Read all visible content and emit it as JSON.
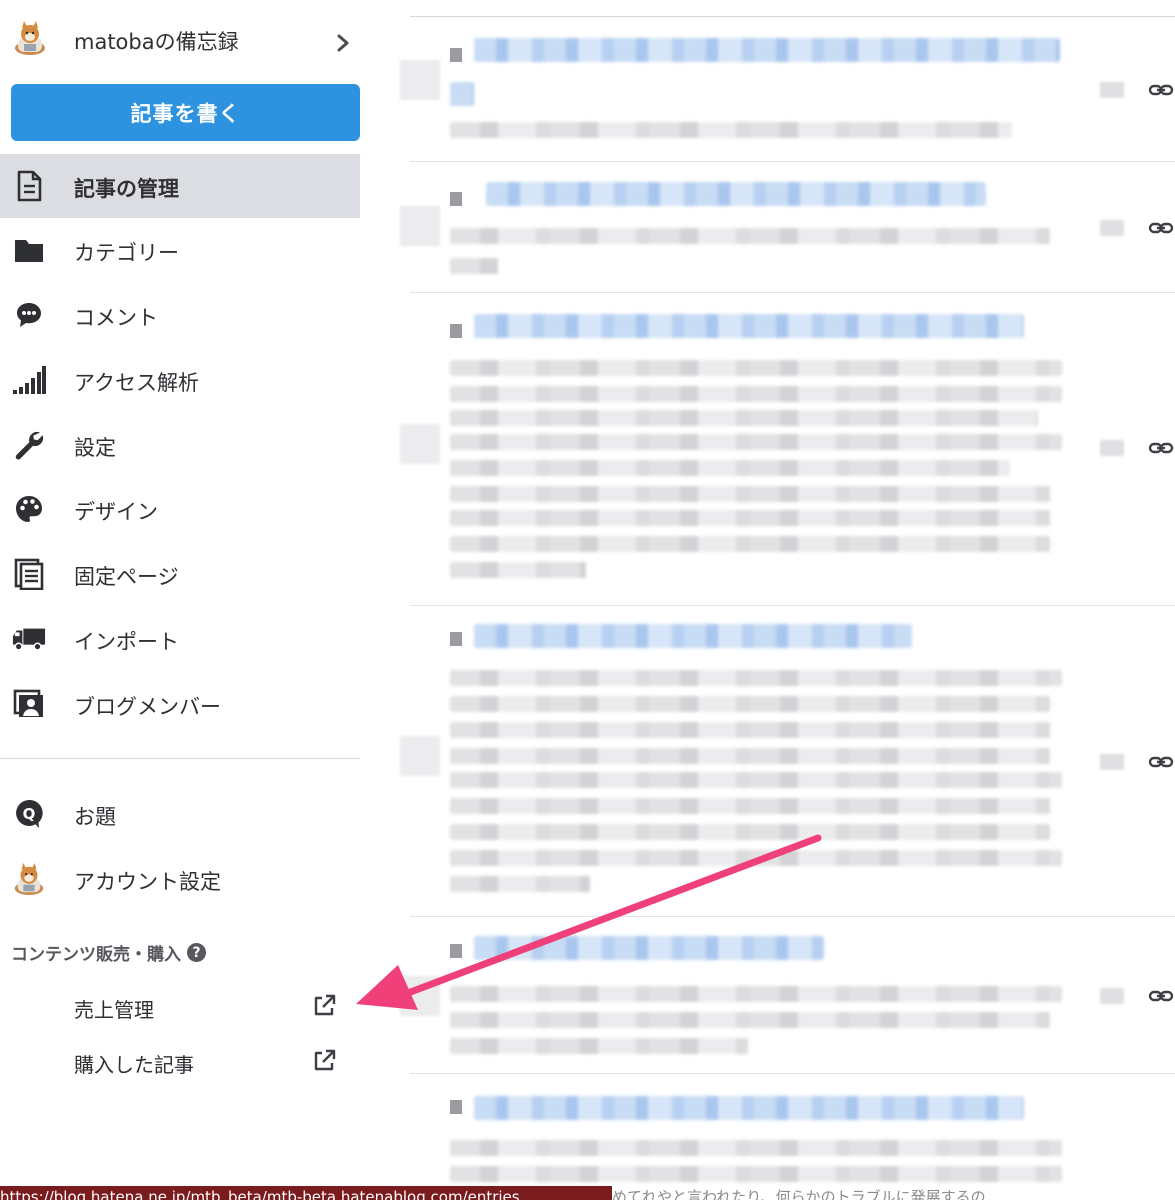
{
  "colors": {
    "accent": "#2d93e0",
    "active_bg": "#dcdde2",
    "arrow": "#f0407a",
    "statusbar_bg": "#7a1b1e"
  },
  "blog": {
    "title": "matobaの備忘録",
    "avatar_icon": "shiba-dog-avatar",
    "chevron_icon": "chevron-right-icon"
  },
  "write_button": {
    "label": "記事を書く"
  },
  "nav": [
    {
      "label": "記事の管理",
      "icon": "document-icon",
      "active": true
    },
    {
      "label": "カテゴリー",
      "icon": "folder-icon"
    },
    {
      "label": "コメント",
      "icon": "comment-bubble-icon"
    },
    {
      "label": "アクセス解析",
      "icon": "signal-bars-icon"
    },
    {
      "label": "設定",
      "icon": "wrench-icon"
    },
    {
      "label": "デザイン",
      "icon": "palette-icon"
    },
    {
      "label": "固定ページ",
      "icon": "pages-icon"
    },
    {
      "label": "インポート",
      "icon": "truck-icon"
    },
    {
      "label": "ブログメンバー",
      "icon": "member-icon"
    }
  ],
  "secondary_nav": [
    {
      "label": "お題",
      "icon": "q-bubble-icon"
    },
    {
      "label": "アカウント設定",
      "icon": "shiba-dog-avatar"
    }
  ],
  "contents_section": {
    "title": "コンテンツ販売・購入",
    "help": "?",
    "items": [
      {
        "label": "売上管理",
        "icon": "external-link-icon"
      },
      {
        "label": "購入した記事",
        "icon": "external-link-icon"
      }
    ]
  },
  "status_bar": {
    "url": "https://blog.hatena.ne.jp/mtb_beta/mtb-beta.hatenablog.com/entries",
    "trailing_text": "めてれやと言われたり、何らかのトラブルに発展するの"
  },
  "entries": {
    "count": 6,
    "link_icon": "link-chain-icon"
  }
}
